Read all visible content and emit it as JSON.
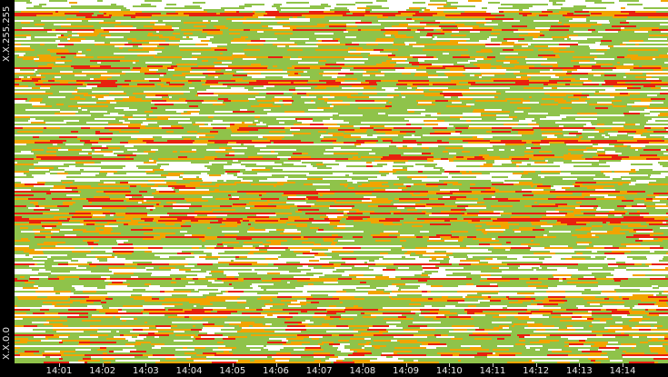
{
  "chart_data": {
    "type": "heatmap",
    "title": "",
    "xlabel": "",
    "ylabel": "",
    "y_axis": {
      "top_label": "X.X.255.255",
      "bottom_label": "X.X.0.0"
    },
    "x_axis": {
      "ticks": [
        "14:01",
        "14:02",
        "14:03",
        "14:04",
        "14:05",
        "14:06",
        "14:07",
        "14:08",
        "14:09",
        "14:10",
        "14:11",
        "14:12",
        "14:13",
        "14:14"
      ]
    },
    "color_scale": [
      "#ffffff",
      "#8fc34a",
      "#f2a400",
      "#e8200e"
    ],
    "grid": false,
    "legend": "none"
  }
}
